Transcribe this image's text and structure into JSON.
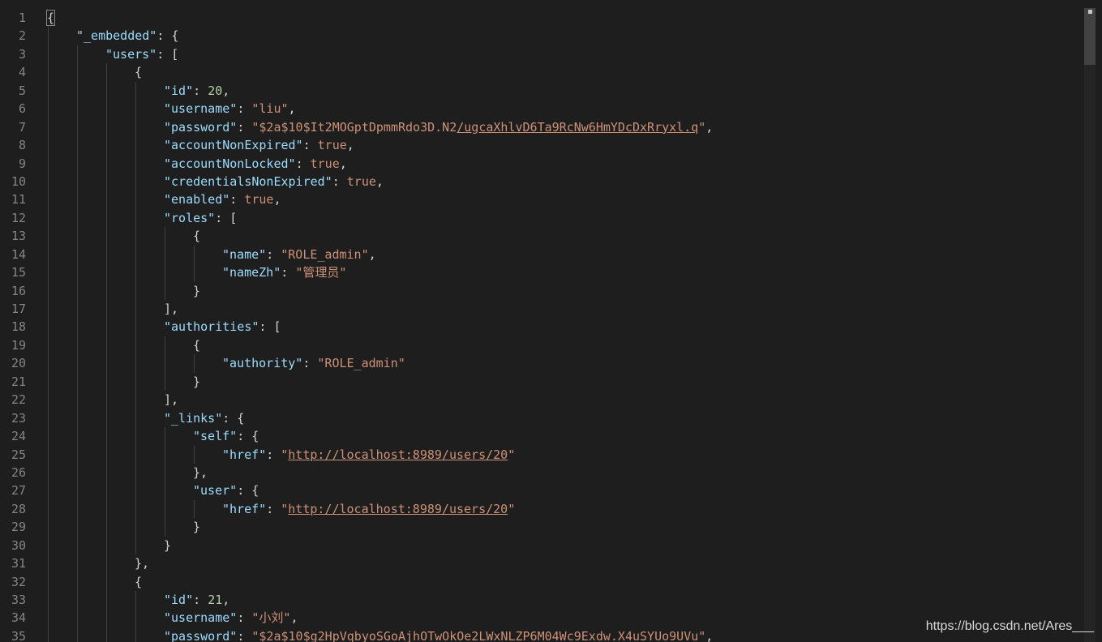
{
  "editor": {
    "language": "json",
    "lines": [
      {
        "n": "1",
        "indent": 0,
        "tokens": [
          [
            "punc",
            "{",
            "match"
          ]
        ]
      },
      {
        "n": "2",
        "indent": 1,
        "tokens": [
          [
            "key",
            "\"_embedded\""
          ],
          [
            "punc",
            ": {"
          ]
        ]
      },
      {
        "n": "3",
        "indent": 2,
        "tokens": [
          [
            "key",
            "\"users\""
          ],
          [
            "punc",
            ": ["
          ]
        ]
      },
      {
        "n": "4",
        "indent": 3,
        "tokens": [
          [
            "punc",
            "{"
          ]
        ]
      },
      {
        "n": "5",
        "indent": 4,
        "tokens": [
          [
            "key",
            "\"id\""
          ],
          [
            "punc",
            ": "
          ],
          [
            "num",
            "20"
          ],
          [
            "punc",
            ","
          ]
        ]
      },
      {
        "n": "6",
        "indent": 4,
        "tokens": [
          [
            "key",
            "\"username\""
          ],
          [
            "punc",
            ": "
          ],
          [
            "str",
            "\"liu\""
          ],
          [
            "punc",
            ","
          ]
        ]
      },
      {
        "n": "7",
        "indent": 4,
        "tokens": [
          [
            "key",
            "\"password\""
          ],
          [
            "punc",
            ": "
          ],
          [
            "str",
            "\"$2a$10$It2MOGptDpmmRdo3D.N2"
          ],
          [
            "str",
            "/ugcaXhlvD6Ta9RcNw6HmYDcDxRryxl.q",
            "link"
          ],
          [
            "str",
            "\""
          ],
          [
            "punc",
            ","
          ]
        ]
      },
      {
        "n": "8",
        "indent": 4,
        "tokens": [
          [
            "key",
            "\"accountNonExpired\""
          ],
          [
            "punc",
            ": "
          ],
          [
            "bool",
            "true"
          ],
          [
            "punc",
            ","
          ]
        ]
      },
      {
        "n": "9",
        "indent": 4,
        "tokens": [
          [
            "key",
            "\"accountNonLocked\""
          ],
          [
            "punc",
            ": "
          ],
          [
            "bool",
            "true"
          ],
          [
            "punc",
            ","
          ]
        ]
      },
      {
        "n": "10",
        "indent": 4,
        "tokens": [
          [
            "key",
            "\"credentialsNonExpired\""
          ],
          [
            "punc",
            ": "
          ],
          [
            "bool",
            "true"
          ],
          [
            "punc",
            ","
          ]
        ]
      },
      {
        "n": "11",
        "indent": 4,
        "tokens": [
          [
            "key",
            "\"enabled\""
          ],
          [
            "punc",
            ": "
          ],
          [
            "bool",
            "true"
          ],
          [
            "punc",
            ","
          ]
        ]
      },
      {
        "n": "12",
        "indent": 4,
        "tokens": [
          [
            "key",
            "\"roles\""
          ],
          [
            "punc",
            ": ["
          ]
        ]
      },
      {
        "n": "13",
        "indent": 5,
        "tokens": [
          [
            "punc",
            "{"
          ]
        ]
      },
      {
        "n": "14",
        "indent": 6,
        "tokens": [
          [
            "key",
            "\"name\""
          ],
          [
            "punc",
            ": "
          ],
          [
            "str",
            "\"ROLE_admin\""
          ],
          [
            "punc",
            ","
          ]
        ]
      },
      {
        "n": "15",
        "indent": 6,
        "tokens": [
          [
            "key",
            "\"nameZh\""
          ],
          [
            "punc",
            ": "
          ],
          [
            "str",
            "\"管理员\""
          ]
        ]
      },
      {
        "n": "16",
        "indent": 5,
        "tokens": [
          [
            "punc",
            "}"
          ]
        ]
      },
      {
        "n": "17",
        "indent": 4,
        "tokens": [
          [
            "punc",
            "],"
          ]
        ]
      },
      {
        "n": "18",
        "indent": 4,
        "tokens": [
          [
            "key",
            "\"authorities\""
          ],
          [
            "punc",
            ": ["
          ]
        ]
      },
      {
        "n": "19",
        "indent": 5,
        "tokens": [
          [
            "punc",
            "{"
          ]
        ]
      },
      {
        "n": "20",
        "indent": 6,
        "tokens": [
          [
            "key",
            "\"authority\""
          ],
          [
            "punc",
            ": "
          ],
          [
            "str",
            "\"ROLE_admin\""
          ]
        ]
      },
      {
        "n": "21",
        "indent": 5,
        "tokens": [
          [
            "punc",
            "}"
          ]
        ]
      },
      {
        "n": "22",
        "indent": 4,
        "tokens": [
          [
            "punc",
            "],"
          ]
        ]
      },
      {
        "n": "23",
        "indent": 4,
        "tokens": [
          [
            "key",
            "\"_links\""
          ],
          [
            "punc",
            ": {"
          ]
        ]
      },
      {
        "n": "24",
        "indent": 5,
        "tokens": [
          [
            "key",
            "\"self\""
          ],
          [
            "punc",
            ": {"
          ]
        ]
      },
      {
        "n": "25",
        "indent": 6,
        "tokens": [
          [
            "key",
            "\"href\""
          ],
          [
            "punc",
            ": "
          ],
          [
            "str",
            "\""
          ],
          [
            "str",
            "http://localhost:8989/users/20",
            "link"
          ],
          [
            "str",
            "\""
          ]
        ]
      },
      {
        "n": "26",
        "indent": 5,
        "tokens": [
          [
            "punc",
            "},"
          ]
        ]
      },
      {
        "n": "27",
        "indent": 5,
        "tokens": [
          [
            "key",
            "\"user\""
          ],
          [
            "punc",
            ": {"
          ]
        ]
      },
      {
        "n": "28",
        "indent": 6,
        "tokens": [
          [
            "key",
            "\"href\""
          ],
          [
            "punc",
            ": "
          ],
          [
            "str",
            "\""
          ],
          [
            "str",
            "http://localhost:8989/users/20",
            "link"
          ],
          [
            "str",
            "\""
          ]
        ]
      },
      {
        "n": "29",
        "indent": 5,
        "tokens": [
          [
            "punc",
            "}"
          ]
        ]
      },
      {
        "n": "30",
        "indent": 4,
        "tokens": [
          [
            "punc",
            "}"
          ]
        ]
      },
      {
        "n": "31",
        "indent": 3,
        "tokens": [
          [
            "punc",
            "},"
          ]
        ]
      },
      {
        "n": "32",
        "indent": 3,
        "tokens": [
          [
            "punc",
            "{"
          ]
        ]
      },
      {
        "n": "33",
        "indent": 4,
        "tokens": [
          [
            "key",
            "\"id\""
          ],
          [
            "punc",
            ": "
          ],
          [
            "num",
            "21"
          ],
          [
            "punc",
            ","
          ]
        ]
      },
      {
        "n": "34",
        "indent": 4,
        "tokens": [
          [
            "key",
            "\"username\""
          ],
          [
            "punc",
            ": "
          ],
          [
            "str",
            "\"小刘\""
          ],
          [
            "punc",
            ","
          ]
        ]
      },
      {
        "n": "35",
        "indent": 4,
        "tokens": [
          [
            "key",
            "\"password\""
          ],
          [
            "punc",
            ": "
          ],
          [
            "str",
            "\"$2a$10$g2HpVqbyoSGoAjhOTwOkOe2LWxNLZP6M04Wc9Exdw.X4uSYUo9UVu\""
          ],
          [
            "punc",
            ","
          ]
        ]
      }
    ]
  },
  "watermark": {
    "text": "https://blog.csdn.net/Ares___"
  }
}
